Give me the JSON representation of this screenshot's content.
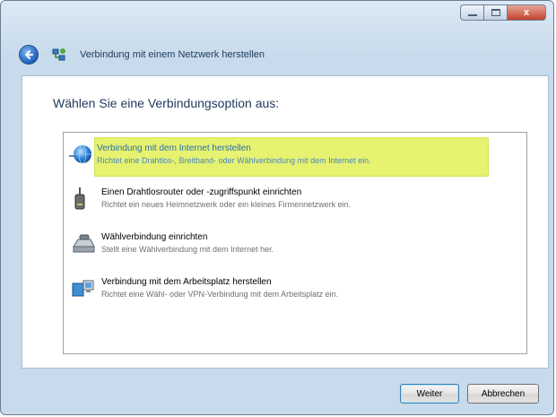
{
  "window": {
    "title": "Verbindung mit einem Netzwerk herstellen"
  },
  "titlebar": {
    "close_label": "x"
  },
  "content": {
    "heading": "Wählen Sie eine Verbindungsoption aus:"
  },
  "options": [
    {
      "icon": "globe-icon",
      "title": "Verbindung mit dem Internet herstellen",
      "description": "Richtet eine Drahtlos-, Breitband- oder Wählverbindung mit dem Internet ein.",
      "selected": true
    },
    {
      "icon": "router-icon",
      "title": "Einen Drahtlosrouter oder -zugriffspunkt einrichten",
      "description": "Richtet ein neues Heimnetzwerk oder ein kleines Firmennetzwerk ein.",
      "selected": false
    },
    {
      "icon": "modem-icon",
      "title": "Wählverbindung einrichten",
      "description": "Stellt eine Wählverbindung mit dem Internet her.",
      "selected": false
    },
    {
      "icon": "workplace-icon",
      "title": "Verbindung mit dem Arbeitsplatz herstellen",
      "description": "Richtet eine Wähl- oder VPN-Verbindung mit dem Arbeitsplatz ein.",
      "selected": false
    }
  ],
  "footer": {
    "next_label": "Weiter",
    "cancel_label": "Abbrechen"
  },
  "colors": {
    "selection_highlight": "#e6f270",
    "heading_text": "#1e395b",
    "close_button": "#c2422c"
  }
}
